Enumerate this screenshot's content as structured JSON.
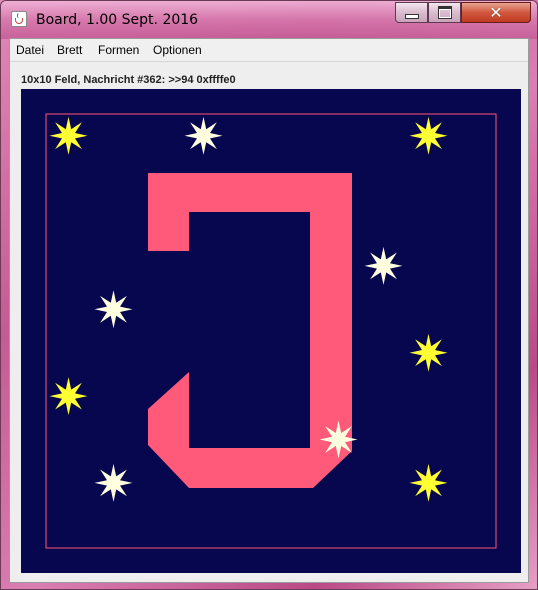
{
  "window": {
    "title": "Board, 1.00 Sept. 2016",
    "controls": [
      "minimize",
      "maximize",
      "close"
    ]
  },
  "menubar": {
    "items": [
      "Datei",
      "Brett",
      "Formen",
      "Optionen"
    ]
  },
  "status": {
    "text": "10x10 Feld, Nachricht #362: >>94 0xffffe0"
  },
  "board": {
    "background_color": "#07074f",
    "border_color": "#ff5577",
    "shape_color": "#ff5a7a",
    "star_colors": {
      "yellow": "#ffff33",
      "white": "#ffffe0"
    },
    "grid_size": "10x10",
    "shape": "J",
    "stars": [
      {
        "col": 1,
        "row": 1,
        "color": "yellow"
      },
      {
        "col": 4,
        "row": 1,
        "color": "white"
      },
      {
        "col": 9,
        "row": 1,
        "color": "yellow"
      },
      {
        "col": 8,
        "row": 4,
        "color": "white"
      },
      {
        "col": 2,
        "row": 5,
        "color": "white"
      },
      {
        "col": 9,
        "row": 6,
        "color": "yellow"
      },
      {
        "col": 1,
        "row": 7,
        "color": "yellow"
      },
      {
        "col": 7,
        "row": 8,
        "color": "white"
      },
      {
        "col": 2,
        "row": 9,
        "color": "white"
      },
      {
        "col": 9,
        "row": 9,
        "color": "yellow"
      }
    ]
  }
}
